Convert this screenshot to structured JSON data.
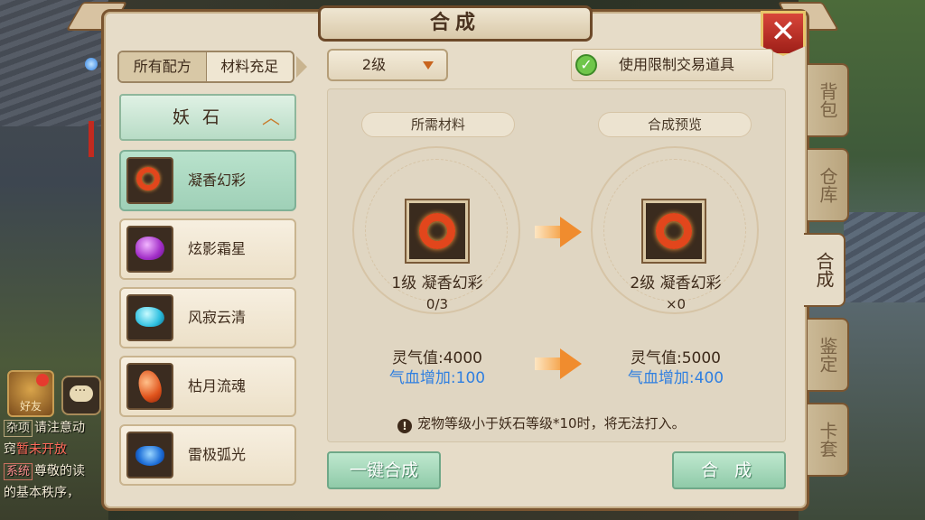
{
  "title": "合成",
  "close_label": "✕",
  "side_tabs": [
    {
      "label": "背包"
    },
    {
      "label": "仓库"
    },
    {
      "label": "合成"
    },
    {
      "label": "鉴定"
    },
    {
      "label": "卡套"
    }
  ],
  "filter_tabs": [
    {
      "label": "所有配方"
    },
    {
      "label": "材料充足"
    }
  ],
  "category": {
    "label": "妖石",
    "chevron_icon": "chevron-up-icon"
  },
  "items": [
    {
      "name": "凝香幻彩",
      "icon": "red-ring-gem-icon"
    },
    {
      "name": "炫影霜星",
      "icon": "purple-gem-icon"
    },
    {
      "name": "风寂云清",
      "icon": "cyan-gem-icon"
    },
    {
      "name": "枯月流魂",
      "icon": "orange-gem-icon"
    },
    {
      "name": "雷极弧光",
      "icon": "blue-gem-icon"
    }
  ],
  "level_select": {
    "value": "2级"
  },
  "limit_toggle": {
    "label": "使用限制交易道具",
    "checked": true
  },
  "required": {
    "section_label": "所需材料",
    "item_name": "1级 凝香幻彩",
    "count": "0/3",
    "stat1": "灵气值:4000",
    "stat2": "气血增加:100"
  },
  "preview": {
    "section_label": "合成预览",
    "item_name": "2级 凝香幻彩",
    "count": "×0",
    "stat1": "灵气值:5000",
    "stat2": "气血增加:400"
  },
  "warning": "宠物等级小于妖石等级*10时，将无法打入。",
  "buttons": {
    "one_click": "一键合成",
    "craft": "合  成"
  },
  "chat": {
    "friend_label": "好友",
    "lines": [
      {
        "tag": "杂项",
        "text": "请注意动"
      },
      {
        "tag": "",
        "text": "窍",
        "highlight": "暂未开放"
      },
      {
        "tag": "系统",
        "text": "尊敬的读"
      },
      {
        "tag": "",
        "text": "的基本秩序，"
      }
    ]
  },
  "colors": {
    "accent_green": "#8fcaa8",
    "stat_blue": "#2f7fe0",
    "close_red": "#c22a1f"
  }
}
